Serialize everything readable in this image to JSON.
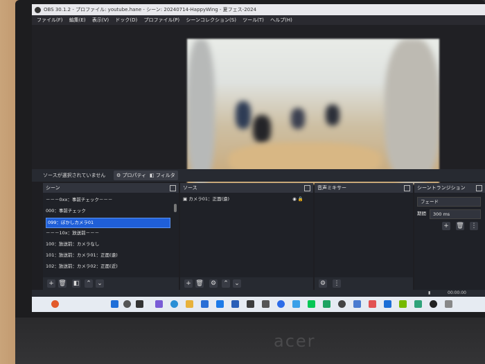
{
  "window": {
    "title": "OBS 30.1.2 - プロファイル: youtube.hane - シーン: 20240714-HappyWing - 夏フェス-2024"
  },
  "menu": [
    "ファイル(F)",
    "編集(E)",
    "表示(V)",
    "ドック(D)",
    "プロファイル(P)",
    "シーンコレクション(S)",
    "ツール(T)",
    "ヘルプ(H)"
  ],
  "controls": {
    "no_source": "ソースが選択されていません",
    "properties": "プロパティ",
    "filters": "フィルタ"
  },
  "docks": {
    "scenes": {
      "title": "シーン",
      "items": [
        "－－－0xx：事前チェック－－－",
        "000：事前チェック",
        "099：ぼかしカメラ01",
        "－－－10x：放送前－－－",
        "100：放送前：カメラなし",
        "101：放送前：カメラ01：正面(遠)",
        "102：放送前：カメラ02：正面(近)"
      ],
      "selected_index": 2
    },
    "sources": {
      "title": "ソース",
      "items": [
        "カメラ01：正面(遠)"
      ]
    },
    "mixer": {
      "title": "音声ミキサー"
    },
    "transitions": {
      "title": "シーントランジション",
      "type": "フェード",
      "duration_label": "期間",
      "duration_value": "300 ms"
    }
  },
  "status": {
    "time": "00:00:00"
  },
  "hardware": {
    "brand": "acer"
  },
  "colors": {
    "selected": "#1f5fd8",
    "dock_bg": "#1f2127"
  }
}
